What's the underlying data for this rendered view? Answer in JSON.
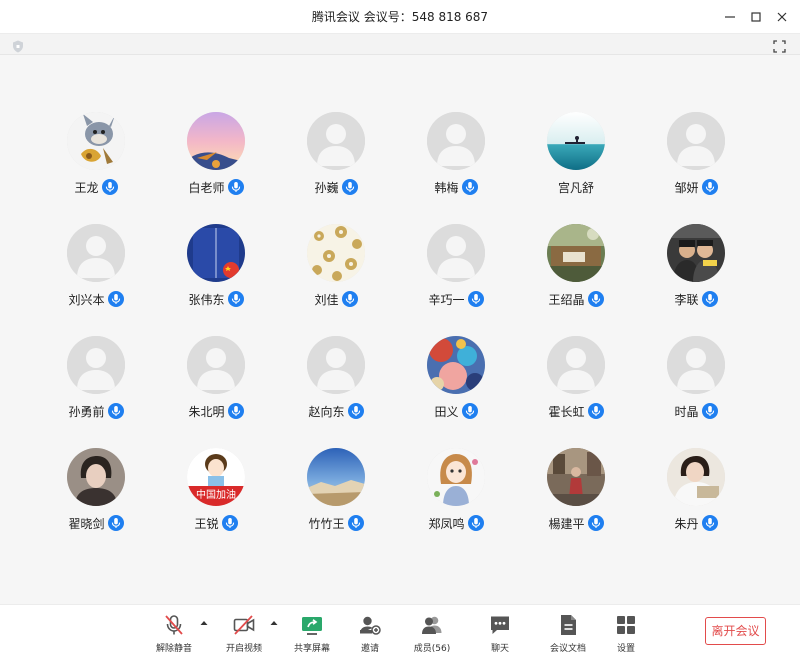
{
  "window": {
    "title": "腾讯会议  会议号：548 818 687"
  },
  "participants": [
    {
      "name": "王龙",
      "avatar": "cartoon-cat",
      "mic": true
    },
    {
      "name": "白老师",
      "avatar": "sunset-photo",
      "mic": true
    },
    {
      "name": "孙巍",
      "avatar": "default",
      "mic": true
    },
    {
      "name": "韩梅",
      "avatar": "default",
      "mic": true
    },
    {
      "name": "宫凡舒",
      "avatar": "sea-photo",
      "mic": false
    },
    {
      "name": "邹妍",
      "avatar": "default",
      "mic": true
    },
    {
      "name": "刘兴本",
      "avatar": "default",
      "mic": true
    },
    {
      "name": "张伟东",
      "avatar": "blue-flag-photo",
      "mic": true
    },
    {
      "name": "刘佳",
      "avatar": "flower-pattern",
      "mic": true
    },
    {
      "name": "辛巧一",
      "avatar": "default",
      "mic": true
    },
    {
      "name": "王绍晶",
      "avatar": "room-photo",
      "mic": true
    },
    {
      "name": "李联",
      "avatar": "couple-photo",
      "mic": true
    },
    {
      "name": "孙勇前",
      "avatar": "default",
      "mic": true
    },
    {
      "name": "朱北明",
      "avatar": "default",
      "mic": true
    },
    {
      "name": "赵向东",
      "avatar": "default",
      "mic": true
    },
    {
      "name": "田义",
      "avatar": "abstract-painting",
      "mic": true
    },
    {
      "name": "霍长虹",
      "avatar": "default",
      "mic": true
    },
    {
      "name": "时晶",
      "avatar": "default",
      "mic": true
    },
    {
      "name": "翟晓剑",
      "avatar": "woman-photo",
      "mic": true
    },
    {
      "name": "王锐",
      "avatar": "cartoon-girl-china",
      "mic": true
    },
    {
      "name": "竹竹王",
      "avatar": "landscape-photo",
      "mic": true
    },
    {
      "name": "郑凤鸣",
      "avatar": "cartoon-girl",
      "mic": true
    },
    {
      "name": "楊建平",
      "avatar": "street-photo",
      "mic": true
    },
    {
      "name": "朱丹",
      "avatar": "woman-reading-photo",
      "mic": true
    }
  ],
  "toolbar": {
    "unmute": "解除静音",
    "start_video": "开启视频",
    "share_screen": "共享屏幕",
    "invite": "邀请",
    "members": "成员(56)",
    "chat": "聊天",
    "documents": "会议文档",
    "settings": "设置",
    "leave": "离开会议"
  },
  "colors": {
    "mic_badge": "#1f7ff0",
    "leave": "#e24b4b",
    "share_icon": "#2aa86b",
    "muted": "#e24b4b"
  }
}
